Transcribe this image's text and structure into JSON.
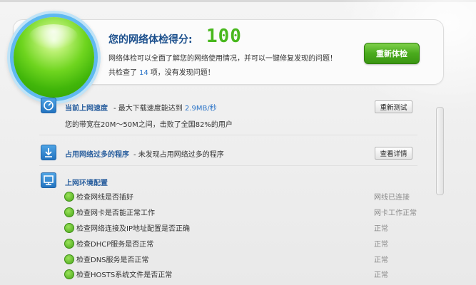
{
  "score": {
    "title": "您的网络体检得分:",
    "value": "100",
    "description": "网络体检可以全面了解您的网络使用情况，并可以一键修复发现的问题！",
    "count_prefix": "共检查了",
    "count_value": "14",
    "count_suffix": "项，没有发现问题！",
    "recheck_label": "重新体检"
  },
  "speed": {
    "title": "当前上网速度",
    "subtitle_prefix": "- 最大下载速度能达到",
    "max_speed": "2.9MB/秒",
    "detail": "您的带宽在20M～50M之间，击败了全国82%的用户",
    "retest_label": "重新测试"
  },
  "programs": {
    "title": "占用网络过多的程序",
    "subtitle": "- 未发现占用网络过多的程序",
    "details_label": "查看详情"
  },
  "environment": {
    "title": "上网环境配置",
    "items": [
      {
        "label": "检查网线是否插好",
        "status": "网线已连接"
      },
      {
        "label": "检查网卡是否能正常工作",
        "status": "网卡工作正常"
      },
      {
        "label": "检查网络连接及IP地址配置是否正确",
        "status": "正常"
      },
      {
        "label": "检查DHCP服务是否正常",
        "status": "正常"
      },
      {
        "label": "检查DNS服务是否正常",
        "status": "正常"
      },
      {
        "label": "检查HOSTS系统文件是否正常",
        "status": "正常"
      }
    ]
  },
  "colors": {
    "accent_blue": "#2a5f9e",
    "score_green": "#49b81e",
    "button_green": "#4aab1d"
  }
}
